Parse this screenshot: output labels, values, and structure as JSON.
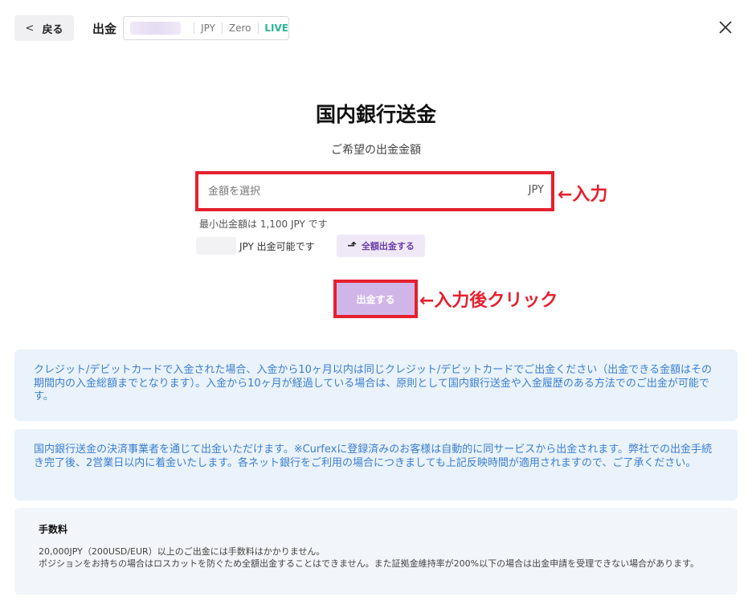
{
  "header": {
    "back_label": "戻る",
    "page_label": "出金",
    "currency": "JPY",
    "account_type": "Zero",
    "mode": "LIVE"
  },
  "main": {
    "title": "国内銀行送金",
    "subtitle": "ご希望の出金金額",
    "amount_placeholder": "金額を選択",
    "amount_unit": "JPY",
    "input_annotation": "←入力",
    "min_text": "最小出金額は 1,100 JPY です",
    "available_text": "JPY 出金可能です",
    "full_withdraw_label": "全額出金する",
    "submit_label": "出金する",
    "submit_annotation": "←入力後クリック"
  },
  "notices": {
    "card_notice": "クレジット/デビットカードで入金された場合、入金から10ヶ月以内は同じクレジット/デビットカードでご出金ください（出金できる金額はその期間内の入金総額までとなります）。入金から10ヶ月が経過している場合は、原則として国内銀行送金や入金履歴のある方法でのご出金が可能です。",
    "bank_notice": "国内銀行送金の決済事業者を通じて出金いただけます。※Curfexに登録済みのお客様は自動的に同サービスから出金されます。弊社での出金手続き完了後、2営業日以内に着金いたします。各ネット銀行をご利用の場合につきましても上記反映時間が適用されますので、ご了承ください。"
  },
  "fee": {
    "title": "手数料",
    "lines": [
      "20,000JPY（200USD/EUR）以上のご出金には手数料はかかりません。",
      "ポジションをお持ちの場合はロスカットを防ぐため全額出金することはできません。また証拠金維持率が200%以下の場合は出金申請を受理できない場合があります。"
    ]
  },
  "colors": {
    "accent_purple": "#d0b6e8",
    "annotation_red": "#e5202e",
    "notice_blue": "#3b7fd0",
    "live_green": "#2bb39a"
  }
}
